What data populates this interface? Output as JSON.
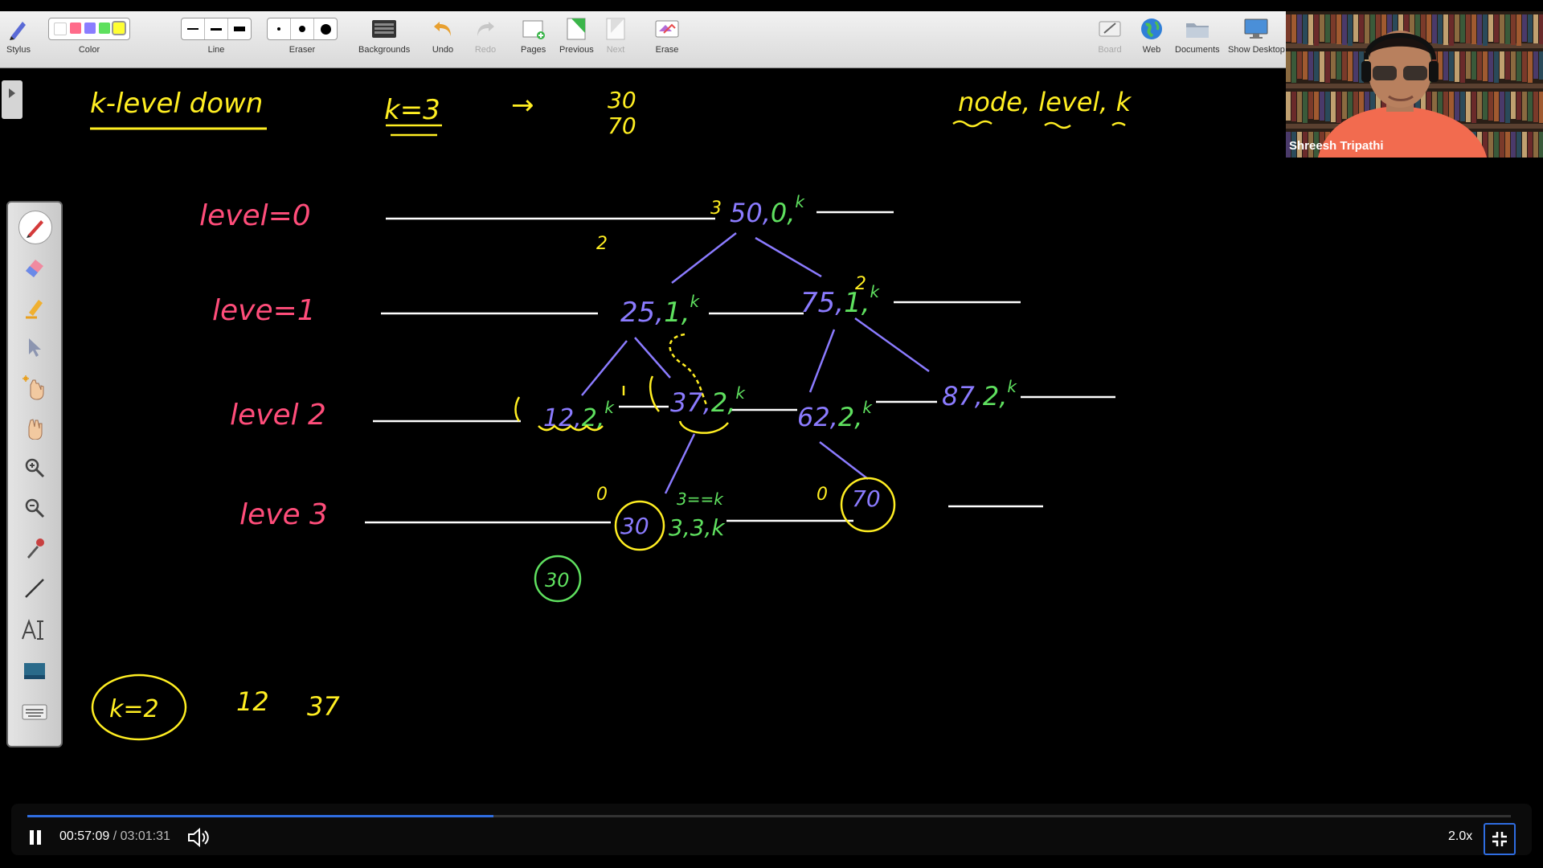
{
  "toolbar": {
    "stylus": "Stylus",
    "color": "Color",
    "line": "Line",
    "eraser": "Eraser",
    "backgrounds": "Backgrounds",
    "undo": "Undo",
    "redo": "Redo",
    "pages": "Pages",
    "previous": "Previous",
    "next": "Next",
    "erase": "Erase",
    "board": "Board",
    "web": "Web",
    "documents": "Documents",
    "show_desktop": "Show Desktop",
    "swatches": [
      "#ffffff",
      "#ff6b8a",
      "#8a7dff",
      "#5ee05e",
      "#ffff33"
    ]
  },
  "webcam": {
    "name": "Shreesh Tripathi"
  },
  "palette": {
    "tools": [
      "pen-icon",
      "eraser-icon",
      "highlighter-icon",
      "pointer-icon",
      "magic-hand-icon",
      "hand-icon",
      "zoom-in-icon",
      "zoom-out-icon",
      "color-picker-icon",
      "line-icon",
      "text-icon",
      "screen-icon",
      "keyboard-icon"
    ]
  },
  "board": {
    "title": "k-level down",
    "k_eq": "k=3",
    "arrow": "→",
    "answer_1": "30",
    "answer_2": "70",
    "params": "node, level, k",
    "level_labels": [
      "level=0",
      "leve=1",
      "level 2",
      "leve 3"
    ],
    "nodes": {
      "n50": "50,0,k",
      "n25": "25,1,k",
      "n75": "75,1,k",
      "n12": "12,2,k",
      "n37": "37,2,k",
      "n62": "62,2,k",
      "n87": "87,2,k",
      "n30": "30",
      "n30_state": "3,3,k",
      "n70": "70",
      "eq_note": "3==k",
      "n30_green": "30"
    },
    "bottom": {
      "k2": "k=2",
      "v12": "12",
      "v37": "37"
    },
    "colors": {
      "yellow": "#ffee22",
      "pink": "#ff4d7a",
      "purple": "#8b7bff",
      "green": "#5fe05f",
      "white": "#ffffff"
    }
  },
  "player": {
    "current": "00:57:09",
    "sep": "/",
    "duration": "03:01:31",
    "speed": "2.0x",
    "progress": 0.314
  }
}
